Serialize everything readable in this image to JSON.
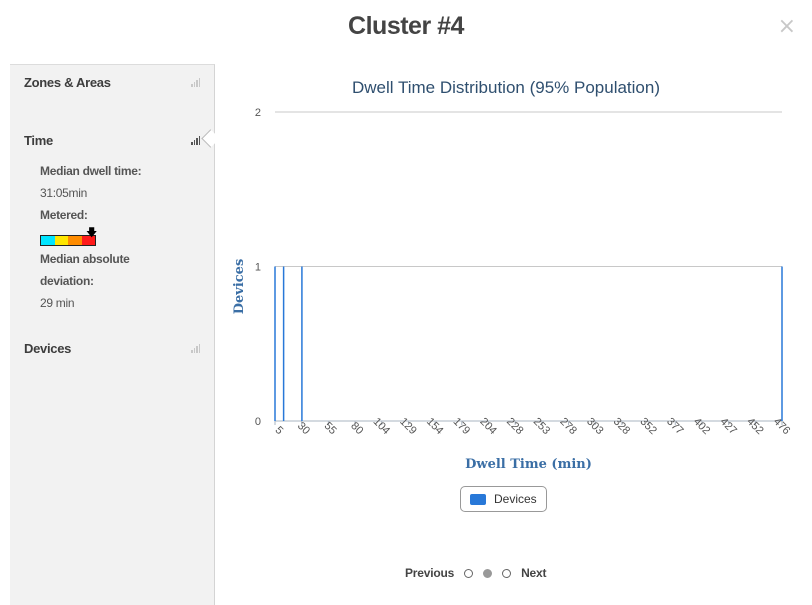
{
  "modal": {
    "title": "Cluster #4",
    "close_label": "×"
  },
  "sidebar": {
    "sections": [
      {
        "label": "Zones & Areas",
        "active": false
      },
      {
        "label": "Time",
        "active": true
      },
      {
        "label": "Devices",
        "active": false
      }
    ],
    "time": {
      "median_label": "Median dwell time:",
      "median_value": "31:05min",
      "metered_label": "Metered:",
      "meter_colors": [
        "#00e5ff",
        "#ffe600",
        "#ff8c00",
        "#ff1a1a"
      ],
      "meter_arrow": "🡇",
      "mad_label_1": "Median absolute",
      "mad_label_2": "deviation:",
      "mad_value": "29 min"
    }
  },
  "chart_data": {
    "type": "bar",
    "title": "Dwell Time Distribution (95% Population)",
    "xlabel": "Dwell Time (min)",
    "ylabel": "Devices",
    "ylim": [
      0,
      2
    ],
    "yticks": [
      "0",
      "1",
      "2"
    ],
    "x_tick_labels": [
      "5",
      "30",
      "55",
      "80",
      "104",
      "129",
      "154",
      "179",
      "204",
      "228",
      "253",
      "278",
      "303",
      "328",
      "352",
      "377",
      "402",
      "427",
      "452",
      "476"
    ],
    "series": [
      {
        "name": "Devices",
        "color": "#2878d8",
        "points": [
          {
            "x": 5,
            "y": 1
          },
          {
            "x": 13,
            "y": 1
          },
          {
            "x": 30,
            "y": 1
          },
          {
            "x": 476,
            "y": 1
          }
        ]
      }
    ],
    "grid": true,
    "legend": "bottom-center"
  },
  "legend": {
    "label": "Devices"
  },
  "pager": {
    "previous": "Previous",
    "next": "Next",
    "pages": 3,
    "current": 1
  }
}
